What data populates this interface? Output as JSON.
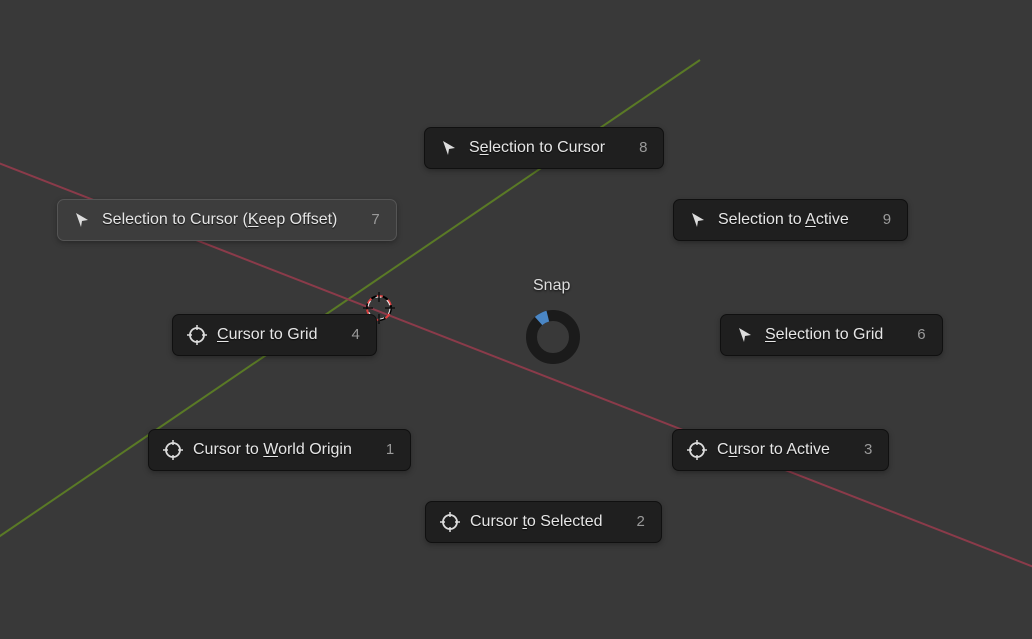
{
  "menu_title": "Snap",
  "ring_progress_deg": 40,
  "items": {
    "sel_to_cursor": {
      "label_pre": "S",
      "label_u": "e",
      "label_post": "lection to Cursor",
      "shortcut": "8",
      "icon": "arrow"
    },
    "sel_to_cursor_keep_offset": {
      "label_pre": "Selection to Cursor (",
      "label_u": "K",
      "label_post": "eep Offset)",
      "shortcut": "7",
      "icon": "arrow"
    },
    "sel_to_active": {
      "label_pre": "Selection to ",
      "label_u": "A",
      "label_post": "ctive",
      "shortcut": "9",
      "icon": "arrow"
    },
    "cursor_to_grid": {
      "label_pre": "",
      "label_u": "C",
      "label_post": "ursor to Grid",
      "shortcut": "4",
      "icon": "cursor"
    },
    "sel_to_grid": {
      "label_pre": "",
      "label_u": "S",
      "label_post": "election to Grid",
      "shortcut": "6",
      "icon": "arrow"
    },
    "cursor_to_world": {
      "label_pre": "Cursor to ",
      "label_u": "W",
      "label_post": "orld Origin",
      "shortcut": "1",
      "icon": "cursor"
    },
    "cursor_to_active": {
      "label_pre": "C",
      "label_u": "u",
      "label_post": "rsor to Active",
      "shortcut": "3",
      "icon": "cursor"
    },
    "cursor_to_selected": {
      "label_pre": "Cursor ",
      "label_u": "t",
      "label_post": "o Selected",
      "shortcut": "2",
      "icon": "cursor"
    }
  }
}
